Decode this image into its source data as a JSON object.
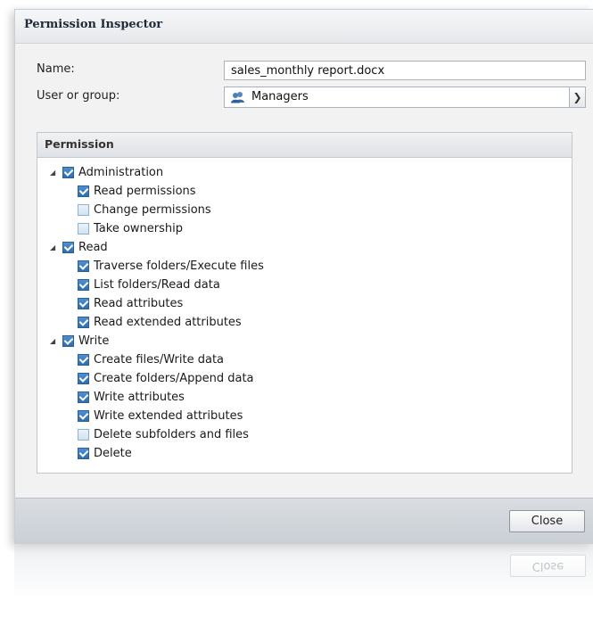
{
  "dialog": {
    "title": "Permission Inspector",
    "name_label": "Name:",
    "name_value": "sales_monthly report.docx",
    "group_label": "User or group:",
    "group_value": "Managers",
    "group_icon": "user-group-icon"
  },
  "permission": {
    "header": "Permission",
    "groups": [
      {
        "label": "Administration",
        "checked": true,
        "items": [
          {
            "label": "Read permissions",
            "checked": true
          },
          {
            "label": "Change permissions",
            "checked": false
          },
          {
            "label": "Take ownership",
            "checked": false
          }
        ]
      },
      {
        "label": "Read",
        "checked": true,
        "items": [
          {
            "label": "Traverse folders/Execute files",
            "checked": true
          },
          {
            "label": "List folders/Read data",
            "checked": true
          },
          {
            "label": "Read attributes",
            "checked": true
          },
          {
            "label": "Read extended attributes",
            "checked": true
          }
        ]
      },
      {
        "label": "Write",
        "checked": true,
        "items": [
          {
            "label": "Create files/Write data",
            "checked": true
          },
          {
            "label": "Create folders/Append data",
            "checked": true
          },
          {
            "label": "Write attributes",
            "checked": true
          },
          {
            "label": "Write extended attributes",
            "checked": true
          },
          {
            "label": "Delete subfolders and files",
            "checked": false
          },
          {
            "label": "Delete",
            "checked": true
          }
        ]
      }
    ]
  },
  "footer": {
    "close_label": "Close"
  },
  "colors": {
    "checkbox_checked": "#2e6db0",
    "checkbox_unchecked": "#cfe2f2",
    "footer_bg": "#cbd0d6"
  }
}
